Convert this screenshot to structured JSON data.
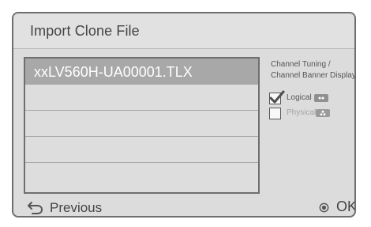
{
  "dialog": {
    "title": "Import Clone File"
  },
  "file_list": {
    "items": [
      {
        "name": "xxLV560H-UA00001.TLX",
        "selected": true
      },
      {
        "name": "",
        "selected": false
      },
      {
        "name": "",
        "selected": false
      },
      {
        "name": "",
        "selected": false
      },
      {
        "name": "",
        "selected": false
      }
    ]
  },
  "channel_options": {
    "heading_line1": "Channel Tuning /",
    "heading_line2": "Channel Banner Display",
    "options": [
      {
        "label": "Logical",
        "checked": true,
        "badge_icon": "two-dot-icon"
      },
      {
        "label": "Physical",
        "checked": false,
        "badge_icon": "three-dot-icon"
      }
    ]
  },
  "footer": {
    "previous_label": "Previous",
    "ok_label": "OK"
  },
  "colors": {
    "panel_background": "#dcdcdc",
    "selected_row": "#a8a8a8",
    "border": "#6e6e6e",
    "primary_text": "#444444",
    "disabled_text": "#a4a4a4"
  }
}
